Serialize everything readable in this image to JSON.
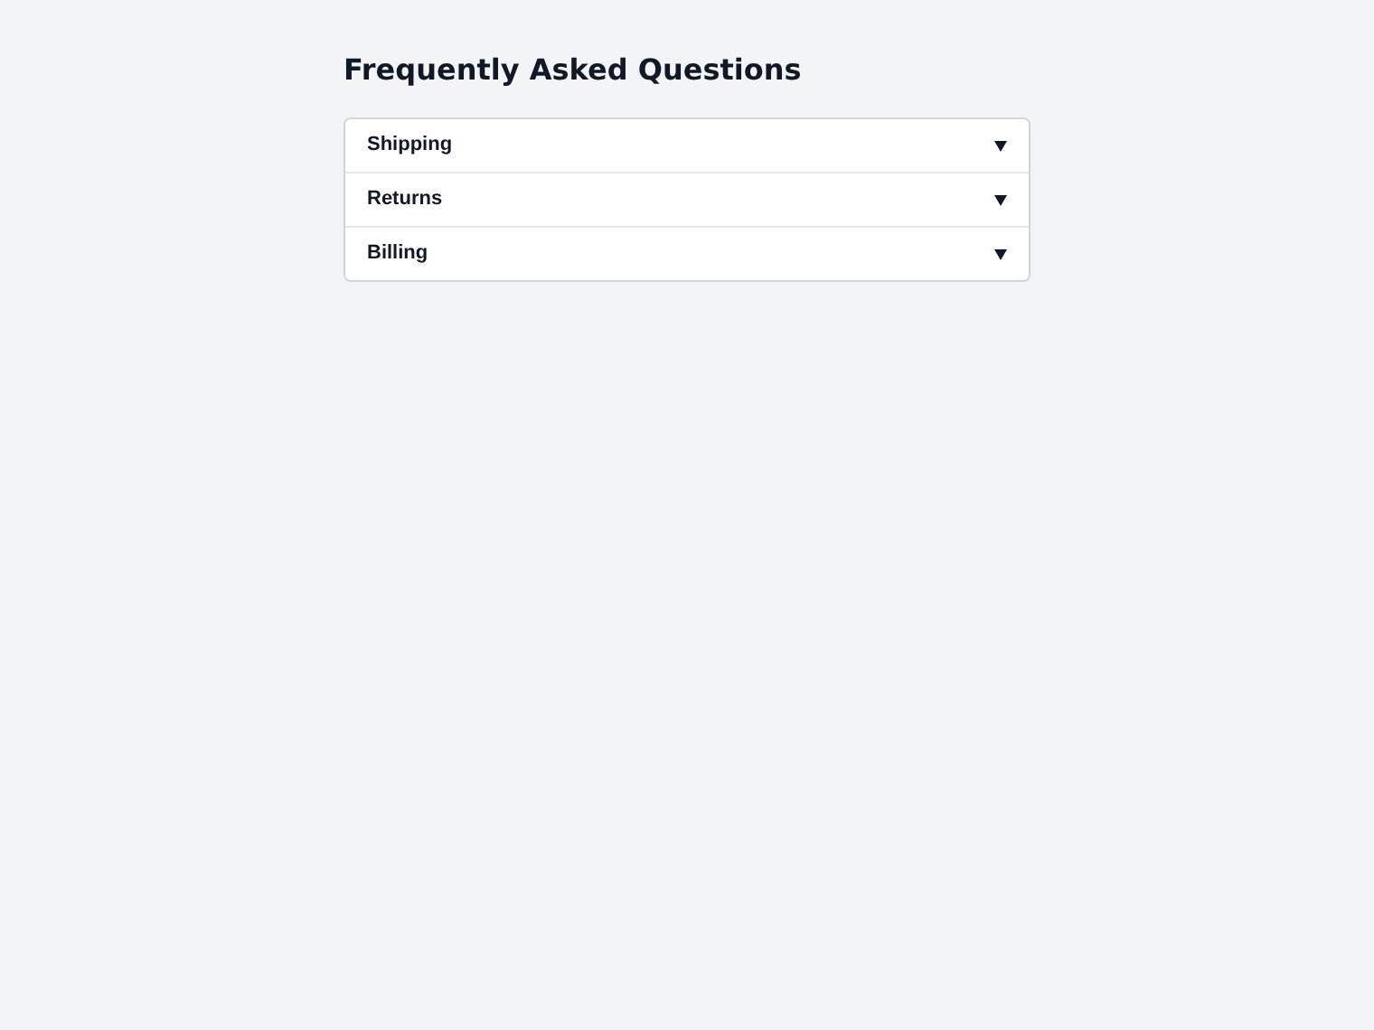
{
  "title": "Frequently Asked Questions",
  "faq": [
    {
      "question": "Shipping",
      "expanded": false
    },
    {
      "question": "Returns",
      "expanded": false
    },
    {
      "question": "Billing",
      "expanded": false
    }
  ]
}
